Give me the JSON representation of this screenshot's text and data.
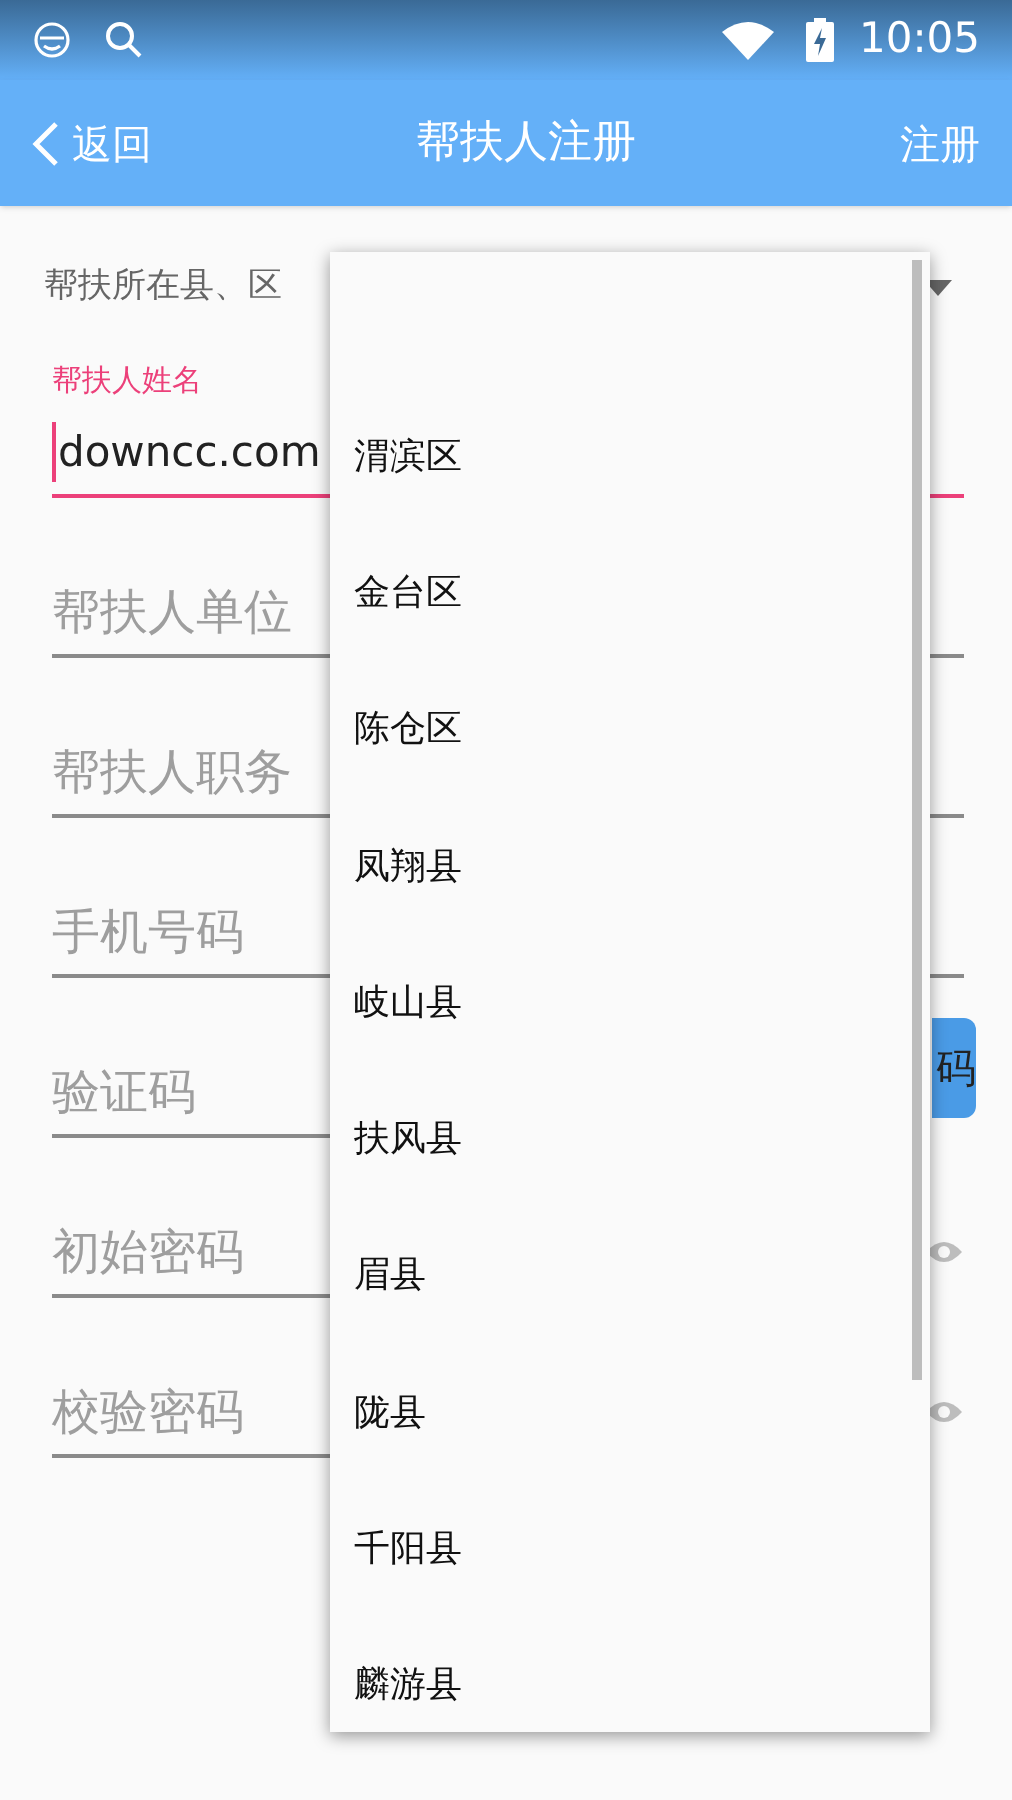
{
  "status_bar": {
    "time": "10:05"
  },
  "header": {
    "back": "返回",
    "title": "帮扶人注册",
    "action": "注册"
  },
  "form": [
    {
      "kind": "spinner",
      "label": "帮扶所在县、区"
    },
    {
      "kind": "text",
      "label": "帮扶人姓名",
      "value": "downcc.com",
      "focused": true
    },
    {
      "kind": "text",
      "placeholder": "帮扶人单位",
      "focused": false
    },
    {
      "kind": "text",
      "placeholder": "帮扶人职务",
      "focused": false
    },
    {
      "kind": "text",
      "placeholder": "手机号码",
      "focused": false
    },
    {
      "kind": "code",
      "placeholder": "验证码",
      "button": "码"
    },
    {
      "kind": "password",
      "placeholder": "初始密码"
    },
    {
      "kind": "password",
      "placeholder": "校验密码"
    }
  ],
  "dropdown": {
    "items": [
      {
        "label": "渭滨区"
      },
      {
        "label": "金台区"
      },
      {
        "label": "陈仓区"
      },
      {
        "label": "凤翔县"
      },
      {
        "label": "岐山县"
      },
      {
        "label": "扶风县"
      },
      {
        "label": "眉县"
      },
      {
        "label": "陇县"
      },
      {
        "label": "千阳县"
      },
      {
        "label": "麟游县"
      }
    ]
  }
}
